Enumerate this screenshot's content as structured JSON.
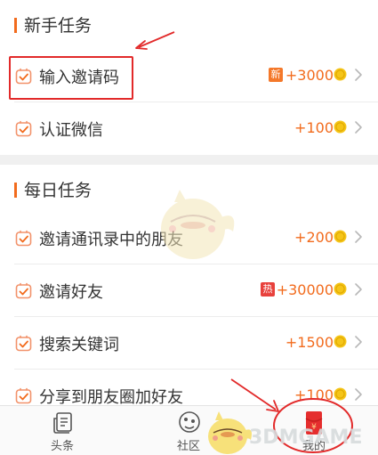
{
  "sections": {
    "newbie": {
      "title": "新手任务",
      "tasks": [
        {
          "label": "输入邀请码",
          "badge": "新",
          "reward": "+3000"
        },
        {
          "label": "认证微信",
          "badge": "",
          "reward": "+100"
        }
      ]
    },
    "daily": {
      "title": "每日任务",
      "tasks": [
        {
          "label": "邀请通讯录中的朋友",
          "badge": "",
          "reward": "+200"
        },
        {
          "label": "邀请好友",
          "badge": "热",
          "reward": "+30000"
        },
        {
          "label": "搜索关键词",
          "badge": "",
          "reward": "+1500"
        },
        {
          "label": "分享到朋友圈加好友",
          "badge": "",
          "reward": "+100"
        }
      ]
    }
  },
  "tabbar": {
    "tabs": [
      {
        "label": "头条",
        "icon": "news-icon"
      },
      {
        "label": "社区",
        "icon": "community-icon"
      },
      {
        "label": "我的",
        "icon": "red-envelope-icon"
      }
    ]
  },
  "watermark": {
    "text": "3DMGAME"
  },
  "colors": {
    "accent": "#f26b1d",
    "annotation": "#e22a2a",
    "new_badge": "#f4782a",
    "hot_badge": "#e8413c",
    "coin": "#f5c518"
  }
}
